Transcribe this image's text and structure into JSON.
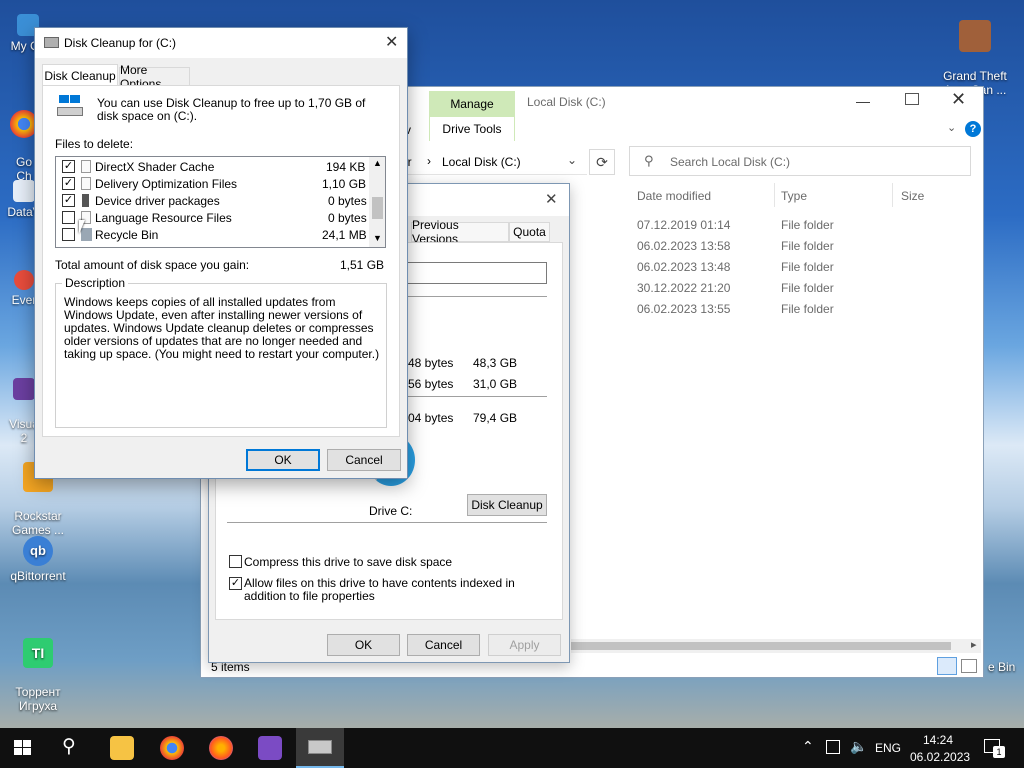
{
  "desktop": {
    "icons": [
      {
        "label": "My Co"
      },
      {
        "label": "Go\nCh"
      },
      {
        "label": "DataV"
      },
      {
        "label": "Ever"
      },
      {
        "label": "Visua\n2"
      },
      {
        "label": "Rockstar\nGames ..."
      },
      {
        "label": "qBittorrent"
      },
      {
        "label": "Торрент\nИгруха"
      },
      {
        "label": "Grand Theft\nAuto San ..."
      }
    ],
    "recycle_bin_partial": "e Bin"
  },
  "explorer": {
    "ribbon_manage": "Manage",
    "ribbon_drive_tools": "Drive Tools",
    "ribbon_view_partial": "v",
    "title": "Local Disk (C:)",
    "address_prefix": "er",
    "address": "Local Disk (C:)",
    "search_placeholder": "Search Local Disk (C:)",
    "columns": {
      "date": "Date modified",
      "type": "Type",
      "size": "Size"
    },
    "rows": [
      {
        "date": "07.12.2019 01:14",
        "type": "File folder"
      },
      {
        "date": "06.02.2023 13:58",
        "type": "File folder"
      },
      {
        "date": "06.02.2023 13:48",
        "type": "File folder"
      },
      {
        "date": "30.12.2022 21:20",
        "type": "File folder"
      },
      {
        "date": "06.02.2023 13:55",
        "type": "File folder"
      }
    ],
    "status": "5 items"
  },
  "properties": {
    "tabs": [
      "Previous Versions",
      "Quota"
    ],
    "rows": [
      {
        "bytes": "48 bytes",
        "size": "48,3 GB"
      },
      {
        "bytes": "56 bytes",
        "size": "31,0 GB"
      },
      {
        "bytes": "04 bytes",
        "size": "79,4 GB"
      }
    ],
    "drive_label": "Drive C:",
    "disk_cleanup_button": "Disk Cleanup",
    "compress_label": "Compress this drive to save disk space",
    "index_label": "Allow files on this drive to have contents indexed in addition to file properties",
    "ok": "OK",
    "cancel": "Cancel",
    "apply": "Apply"
  },
  "cleanup": {
    "title": "Disk Cleanup for  (C:)",
    "tabs": [
      "Disk Cleanup",
      "More Options"
    ],
    "intro": "You can use Disk Cleanup to free up to 1,70 GB of disk space on  (C:).",
    "files_label": "Files to delete:",
    "items": [
      {
        "name": "DirectX Shader Cache",
        "size": "194 KB",
        "checked": true
      },
      {
        "name": "Delivery Optimization Files",
        "size": "1,10 GB",
        "checked": true
      },
      {
        "name": "Device driver packages",
        "size": "0 bytes",
        "checked": true
      },
      {
        "name": "Language Resource Files",
        "size": "0 bytes",
        "checked": false
      },
      {
        "name": "Recycle Bin",
        "size": "24,1 MB",
        "checked": false
      }
    ],
    "total_label": "Total amount of disk space you gain:",
    "total_value": "1,51 GB",
    "description_label": "Description",
    "description": "Windows keeps copies of all installed updates from Windows Update, even after installing newer versions of updates. Windows Update cleanup deletes or compresses older versions of updates that are no longer needed and taking up space. (You might need to restart your computer.)",
    "ok": "OK",
    "cancel": "Cancel"
  },
  "taskbar": {
    "language": "ENG",
    "time": "14:24",
    "date": "06.02.2023",
    "notification_count": "1"
  },
  "colors": {
    "accent": "#0078d7",
    "manage_tab": "#cfe9b8",
    "taskbar": "#101010"
  }
}
